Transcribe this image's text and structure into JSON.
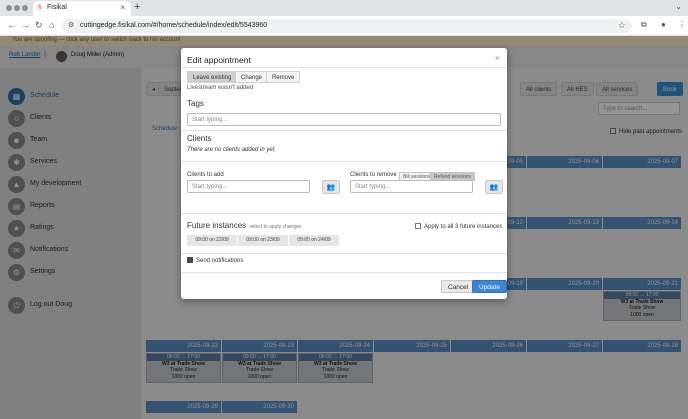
{
  "browser": {
    "tab_title": "Fisikal",
    "tab_favicon": "fi",
    "url": "cuttingedge.fisikal.com/#/home/schedule/index/edit/5543960",
    "tab_close_icon": "×",
    "new_tab_icon": "+",
    "back_icon": "←",
    "forward_icon": "→",
    "reload_icon": "↻",
    "home_icon": "⌂",
    "site_info_icon": "⚙",
    "star_icon": "☆",
    "extensions_icon": "⧉",
    "profile_icon": "●",
    "menu_icon": "⋮",
    "dropdown_icon": "⌄"
  },
  "app": {
    "spoof_banner": "You are spoofing — click any user to switch back to his account",
    "admin_link": "Rob Lander",
    "separator": "|",
    "current_user": "Doug Miller (Admin)",
    "sidebar": [
      {
        "label": "Schedule",
        "icon": "▦",
        "active": true
      },
      {
        "label": "Clients",
        "icon": "☺",
        "active": false
      },
      {
        "label": "Team",
        "icon": "☻",
        "active": false
      },
      {
        "label": "Services",
        "icon": "✱",
        "active": false
      },
      {
        "label": "My development",
        "icon": "▲",
        "active": false
      },
      {
        "label": "Reports",
        "icon": "▤",
        "active": false
      },
      {
        "label": "Ratings",
        "icon": "★",
        "active": false
      },
      {
        "label": "Notifications",
        "icon": "✉",
        "active": false
      },
      {
        "label": "Settings",
        "icon": "⚙",
        "active": false
      },
      {
        "label": "Log out Doug",
        "icon": "⏻",
        "active": false
      }
    ],
    "toolbar": {
      "prev_label": "◂",
      "month_label": "Septem",
      "all_clients": "All clients",
      "all_hes": "All HES",
      "all_services": "All services",
      "book": "Book"
    },
    "search_placeholder": "Type to search...",
    "hide_past": "Hide past appointments",
    "schedule_link": "Schedule"
  },
  "calendar": {
    "header_row_1": [
      "2025-09-05",
      "2025-09-06",
      "2025-09-07"
    ],
    "header_row_2": [
      "2025-09-12",
      "2025-09-13",
      "2025-09-14"
    ],
    "header_row_3": [
      "2025-09-19",
      "2025-09-20",
      "2025-09-21"
    ],
    "header_row_4": [
      "2025-09-22",
      "2025-09-23",
      "2025-09-24",
      "2025-09-25",
      "2025-09-26",
      "2025-09-27",
      "2025-09-28"
    ],
    "header_row_5": [
      "2025-09-29",
      "2025-09-30"
    ],
    "event": {
      "time": "09:00 → 17:00",
      "name": "W3 at Trade Show",
      "type": "Trade Show",
      "capacity": "1000 open"
    }
  },
  "modal": {
    "title": "Edit appointment",
    "close": "×",
    "livestream_options": [
      "Leave existing",
      "Change",
      "Remove"
    ],
    "livestream_note": "Livestream wasn't added",
    "tags_heading": "Tags",
    "tags_placeholder": "Start typing...",
    "clients_heading": "Clients",
    "clients_empty": "There are no clients added in yet",
    "clients_to_add_label": "Clients to add",
    "clients_to_add_placeholder": "Start typing...",
    "clients_to_remove_label": "Clients to remove",
    "session_options": [
      "Bill sessions",
      "Refund sessions"
    ],
    "clients_to_remove_placeholder": "Start typing...",
    "group_icon": "👥",
    "future_heading": "Future instances",
    "future_sub": "select to apply changes",
    "apply_all": "Apply to all 3 future instances",
    "instances": [
      "09:00 on 22/09",
      "09:00 on 23/09",
      "09:00 on 24/09"
    ],
    "send_notifications": "Send notifications",
    "cancel": "Cancel",
    "update": "Update"
  }
}
